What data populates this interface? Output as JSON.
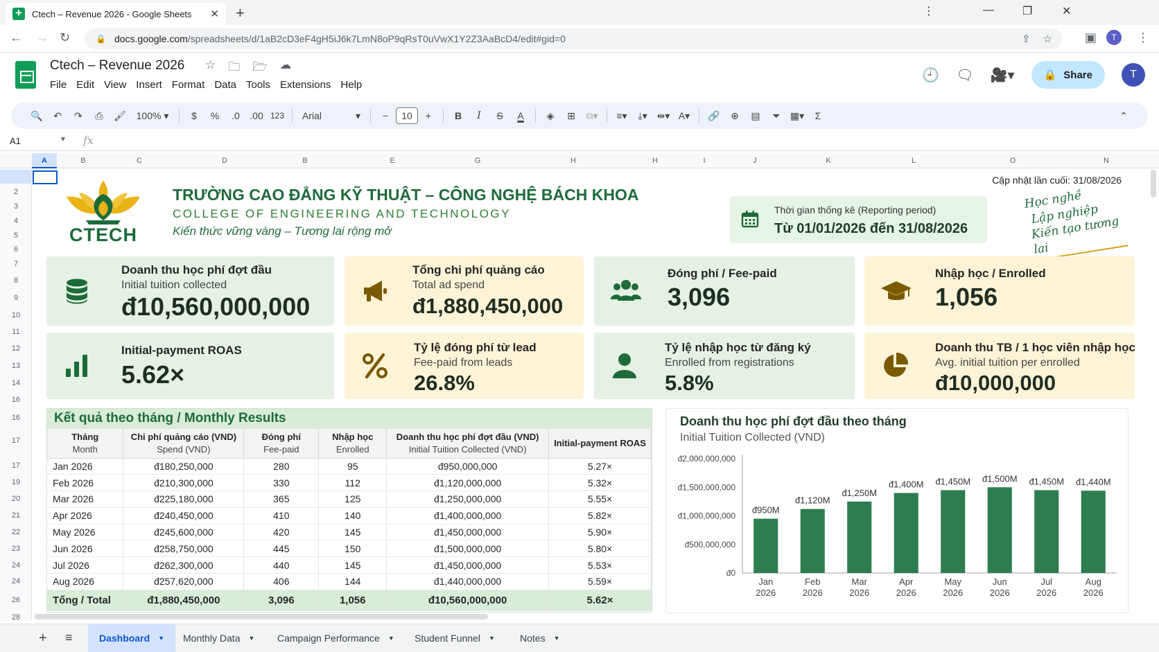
{
  "browser": {
    "tab_title": "Ctech – Revenue 2026 - Google Sheets",
    "url_host": "docs.google.com",
    "url_path": "/spreadsheets/d/1aB2cD3eF4gH5iJ6k7LmN8oP9qRsT0uVwX1Y2Z3AaBcD4/edit#gid=0",
    "profile_initial": "T"
  },
  "sheets": {
    "doc_title": "Ctech – Revenue 2026",
    "menu": [
      "File",
      "Edit",
      "View",
      "Insert",
      "Format",
      "Data",
      "Tools",
      "Extensions",
      "Help"
    ],
    "share_label": "Share",
    "avatar_initial": "T",
    "toolbar": {
      "zoom": "100%",
      "currency": "$",
      "percent": "%",
      "dec_decrease": ".0",
      "dec_increase": ".00",
      "number_format": "123",
      "font": "Arial",
      "font_size": "10"
    },
    "name_box": "A1",
    "fx": "fx",
    "columns": [
      "A",
      "B",
      "C",
      "D",
      "B",
      "E",
      "G",
      "H",
      "H",
      "I",
      "J",
      "K",
      "L",
      "O",
      "N"
    ],
    "rows": [
      "1",
      "2",
      "3",
      "4",
      "5",
      "6",
      "7",
      "8",
      "9",
      "10",
      "11",
      "12",
      "13",
      "14",
      "16",
      "16",
      "17",
      "17",
      "19",
      "20",
      "21",
      "22",
      "23",
      "24",
      "24",
      "26",
      "28"
    ]
  },
  "header": {
    "logo_text": "CTECH",
    "school_name": "TRƯỜNG CAO ĐẲNG KỸ THUẬT – CÔNG NGHỆ BÁCH KHOA",
    "school_en": "COLLEGE OF ENGINEERING AND TECHNOLOGY",
    "motto": "Kiến thức vững vàng – Tương lai rộng mở",
    "updated": "Cập nhật lần cuối: 31/08/2026",
    "period_label": "Thời gian thống kê (Reporting period)",
    "period_value": "Từ 01/01/2026 đến 31/08/2026",
    "slogan": [
      "Học nghề",
      "Lập nghiệp",
      "Kiến tạo tương lai"
    ],
    "colors": {
      "brand_green": "#1e6b3a",
      "gold": "#d4a017",
      "bar_green": "#2e7d4f"
    }
  },
  "kpis": [
    {
      "title": "Doanh thu học phí đợt đầu",
      "sub": "Initial tuition collected",
      "value": "đ10,560,000,000",
      "icon": "database-icon"
    },
    {
      "title": "Tổng chi phí quảng cáo",
      "sub": "Total ad spend",
      "value": "đ1,880,450,000",
      "icon": "megaphone-icon"
    },
    {
      "title": "Đóng phí / Fee-paid",
      "sub": "",
      "value": "3,096",
      "icon": "users-icon"
    },
    {
      "title": "Nhập học / Enrolled",
      "sub": "",
      "value": "1,056",
      "icon": "graduation-cap-icon"
    },
    {
      "title": "Initial-payment ROAS",
      "sub": "",
      "value": "5.62×",
      "icon": "bar-chart-icon"
    },
    {
      "title": "Tỷ lệ đóng phí từ lead",
      "sub": "Fee-paid from leads",
      "value": "26.8%",
      "icon": "percent-icon"
    },
    {
      "title": "Tỷ lệ nhập học từ đăng ký",
      "sub": "Enrolled from registrations",
      "value": "5.8%",
      "icon": "user-icon"
    },
    {
      "title": "Doanh thu TB / 1 học viên nhập học",
      "sub": "Avg. initial tuition per enrolled",
      "value": "đ10,000,000",
      "icon": "pie-chart-icon"
    }
  ],
  "table": {
    "title": "Kết quả theo tháng / Monthly Results",
    "headers": [
      {
        "main": "Tháng",
        "sub": "Month"
      },
      {
        "main": "Chi phí quảng cáo (VND)",
        "sub": "Spend (VND)"
      },
      {
        "main": "Đóng phí",
        "sub": "Fee-paid"
      },
      {
        "main": "Nhập học",
        "sub": "Enrolled"
      },
      {
        "main": "Doanh thu học phí đợt đầu (VND)",
        "sub": "Initial Tuition Collected (VND)"
      },
      {
        "main": "Initial-payment ROAS",
        "sub": ""
      }
    ],
    "rows": [
      [
        "Jan 2026",
        "đ180,250,000",
        "280",
        "95",
        "đ950,000,000",
        "5.27×"
      ],
      [
        "Feb 2026",
        "đ210,300,000",
        "330",
        "112",
        "đ1,120,000,000",
        "5.32×"
      ],
      [
        "Mar 2026",
        "đ225,180,000",
        "365",
        "125",
        "đ1,250,000,000",
        "5.55×"
      ],
      [
        "Apr 2026",
        "đ240,450,000",
        "410",
        "140",
        "đ1,400,000,000",
        "5.82×"
      ],
      [
        "May 2026",
        "đ245,600,000",
        "420",
        "145",
        "đ1,450,000,000",
        "5.90×"
      ],
      [
        "Jun 2026",
        "đ258,750,000",
        "445",
        "150",
        "đ1,500,000,000",
        "5.80×"
      ],
      [
        "Jul 2026",
        "đ262,300,000",
        "440",
        "145",
        "đ1,450,000,000",
        "5.53×"
      ],
      [
        "Aug 2026",
        "đ257,620,000",
        "406",
        "144",
        "đ1,440,000,000",
        "5.59×"
      ]
    ],
    "total": [
      "Tổng / Total",
      "đ1,880,450,000",
      "3,096",
      "1,056",
      "đ10,560,000,000",
      "5.62×"
    ]
  },
  "chart_data": {
    "type": "bar",
    "title": "Doanh thu học phí đợt đầu theo tháng",
    "subtitle": "Initial Tuition Collected (VND)",
    "categories": [
      [
        "Jan",
        "2026"
      ],
      [
        "Feb",
        "2026"
      ],
      [
        "Mar",
        "2026"
      ],
      [
        "Apr",
        "2026"
      ],
      [
        "May",
        "2026"
      ],
      [
        "Jun",
        "2026"
      ],
      [
        "Jul",
        "2026"
      ],
      [
        "Aug",
        "2026"
      ]
    ],
    "values": [
      950000000,
      1120000000,
      1250000000,
      1400000000,
      1450000000,
      1500000000,
      1450000000,
      1440000000
    ],
    "data_labels": [
      "đ950M",
      "đ1,120M",
      "đ1,250M",
      "đ1,400M",
      "đ1,450M",
      "đ1,500M",
      "đ1,450M",
      "đ1,440M"
    ],
    "yticks": [
      0,
      500000000,
      1000000000,
      1500000000,
      2000000000
    ],
    "ytick_labels": [
      "đ0",
      "đ500,000,000",
      "đ1,000,000,000",
      "đ1,500,000,000",
      "đ2,000,000,000"
    ],
    "ylim": [
      0,
      2000000000
    ],
    "color": "#2e7d4f",
    "grid": false
  },
  "sheet_tabs": [
    "Dashboard",
    "Monthly Data",
    "Campaign Performance",
    "Student Funnel",
    "Notes"
  ]
}
